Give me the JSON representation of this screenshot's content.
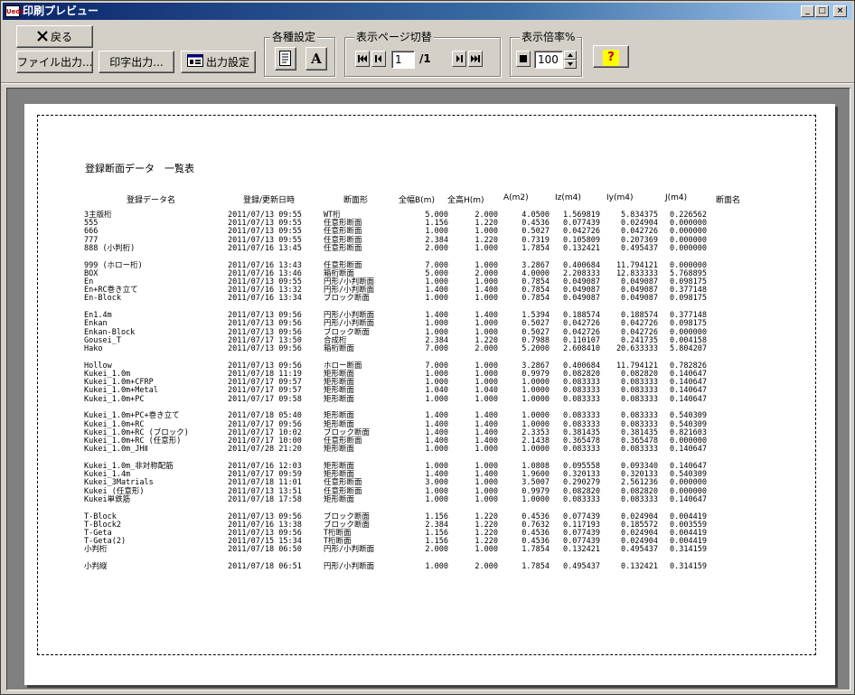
{
  "window": {
    "title": "印刷プレビュー",
    "app_icon": "app-logo-icon"
  },
  "toolbar": {
    "back_label": "戻る",
    "file_output_label": "ファイル出力...",
    "print_output_label": "印字出力...",
    "output_settings_label": "出力設定",
    "settings_group_label": "各種設定",
    "page_group_label": "表示ページ切替",
    "page_current": "1",
    "page_total": "/1",
    "zoom_group_label": "表示倍率%",
    "zoom_value": "100",
    "font_button_glyph": "A",
    "help_glyph": "?"
  },
  "document": {
    "title": "登録断面データ　一覧表",
    "headers": [
      "登録データ名",
      "登録/更新日時",
      "断面形",
      "全幅B(m)",
      "全高H(m)",
      "A(m2)",
      "Iz(m4)",
      "Iy(m4)",
      "J(m4)",
      "断面名"
    ],
    "groups": [
      [
        [
          "3主版桁",
          "2011/07/13 09:55",
          "WT桁",
          "5.000",
          "2.000",
          "4.0500",
          "1.569819",
          "5.834375",
          "0.226562"
        ],
        [
          "555",
          "2011/07/13 09:55",
          "任意形断面",
          "1.156",
          "1.220",
          "0.4536",
          "0.077439",
          "0.024904",
          "0.000000"
        ],
        [
          "666",
          "2011/07/13 09:55",
          "任意形断面",
          "1.000",
          "1.000",
          "0.5027",
          "0.042726",
          "0.042726",
          "0.000000"
        ],
        [
          "777",
          "2011/07/13 09:55",
          "任意形断面",
          "2.384",
          "1.220",
          "0.7319",
          "0.105809",
          "0.207369",
          "0.000000"
        ],
        [
          "888 (小判桁)",
          "2011/07/16 13:45",
          "任意形断面",
          "2.000",
          "1.000",
          "1.7854",
          "0.132421",
          "0.495437",
          "0.000000"
        ]
      ],
      [
        [
          "999 (ホロー桁)",
          "2011/07/16 13:43",
          "任意形断面",
          "7.000",
          "1.000",
          "3.2867",
          "0.400684",
          "11.794121",
          "0.000000"
        ],
        [
          "BOX",
          "2011/07/16 13:46",
          "箱桁断面",
          "5.000",
          "2.000",
          "4.0000",
          "2.208333",
          "12.833333",
          "5.768895"
        ],
        [
          "En",
          "2011/07/13 09:55",
          "円形/小判断面",
          "1.000",
          "1.000",
          "0.7854",
          "0.049087",
          "0.049087",
          "0.098175"
        ],
        [
          "En+RC巻き立て",
          "2011/07/16 13:32",
          "円形/小判断面",
          "1.400",
          "1.400",
          "0.7854",
          "0.049087",
          "0.049087",
          "0.377148"
        ],
        [
          "En-Block",
          "2011/07/16 13:34",
          "ブロック断面",
          "1.000",
          "1.000",
          "0.7854",
          "0.049087",
          "0.049087",
          "0.098175"
        ]
      ],
      [
        [
          "En1.4m",
          "2011/07/13 09:56",
          "円形/小判断面",
          "1.400",
          "1.400",
          "1.5394",
          "0.188574",
          "0.188574",
          "0.377148"
        ],
        [
          "Enkan",
          "2011/07/13 09:56",
          "円形/小判断面",
          "1.000",
          "1.000",
          "0.5027",
          "0.042726",
          "0.042726",
          "0.098175"
        ],
        [
          "Enkan-Block",
          "2011/07/13 09:56",
          "ブロック断面",
          "1.000",
          "1.000",
          "0.5027",
          "0.042726",
          "0.042726",
          "0.000000"
        ],
        [
          "Gousei_T",
          "2011/07/17 13:50",
          "合成桁",
          "2.384",
          "1.220",
          "0.7988",
          "0.110107",
          "0.241735",
          "0.004158"
        ],
        [
          "Hako",
          "2011/07/13 09:56",
          "箱桁断面",
          "7.000",
          "2.000",
          "5.2000",
          "2.608410",
          "20.633333",
          "5.804207"
        ]
      ],
      [
        [
          "Hollow",
          "2011/07/13 09:56",
          "ホロー断面",
          "7.000",
          "1.000",
          "3.2867",
          "0.400684",
          "11.794121",
          "0.782826"
        ],
        [
          "Kukei_1.0m",
          "2011/07/18 11:19",
          "矩形断面",
          "1.000",
          "1.000",
          "0.9979",
          "0.082820",
          "0.082820",
          "0.140647"
        ],
        [
          "Kukei_1.0m+CFRP",
          "2011/07/17 09:57",
          "矩形断面",
          "1.000",
          "1.000",
          "1.0000",
          "0.083333",
          "0.083333",
          "0.140647"
        ],
        [
          "Kukei_1.0m+Metal",
          "2011/07/17 09:57",
          "矩形断面",
          "1.040",
          "1.040",
          "1.0000",
          "0.083333",
          "0.083333",
          "0.140647"
        ],
        [
          "Kukei_1.0m+PC",
          "2011/07/17 09:58",
          "矩形断面",
          "1.000",
          "1.000",
          "1.0000",
          "0.083333",
          "0.083333",
          "0.140647"
        ]
      ],
      [
        [
          "Kukei_1.0m+PC+巻き立て",
          "2011/07/18 05:40",
          "矩形断面",
          "1.400",
          "1.400",
          "1.0000",
          "0.083333",
          "0.083333",
          "0.540309"
        ],
        [
          "Kukei_1.0m+RC",
          "2011/07/17 09:56",
          "矩形断面",
          "1.400",
          "1.400",
          "1.0000",
          "0.083333",
          "0.083333",
          "0.540309"
        ],
        [
          "Kukei_1.0m+RC (ブロック)",
          "2011/07/17 10:02",
          "ブロック断面",
          "1.400",
          "1.400",
          "2.3353",
          "0.381435",
          "0.381435",
          "0.821603"
        ],
        [
          "Kukei_1.0m+RC (任意形)",
          "2011/07/17 10:00",
          "任意形断面",
          "1.400",
          "1.400",
          "2.1438",
          "0.365478",
          "0.365478",
          "0.000000"
        ],
        [
          "Kukei_1.0m_JHⅡ",
          "2011/07/28 21:20",
          "矩形断面",
          "1.000",
          "1.000",
          "1.0000",
          "0.083333",
          "0.083333",
          "0.140647"
        ]
      ],
      [
        [
          "Kukei_1.0m_非対称配筋",
          "2011/07/16 12:03",
          "矩形断面",
          "1.000",
          "1.000",
          "1.0808",
          "0.095558",
          "0.093340",
          "0.140647"
        ],
        [
          "Kukei_1.4m",
          "2011/07/17 09:59",
          "矩形断面",
          "1.400",
          "1.400",
          "1.9600",
          "0.320133",
          "0.320133",
          "0.540309"
        ],
        [
          "Kukei_3Matrials",
          "2011/07/18 11:01",
          "任意形断面",
          "3.000",
          "1.000",
          "3.5007",
          "0.290279",
          "2.561236",
          "0.000000"
        ],
        [
          "Kukei (任意形)",
          "2011/07/13 13:51",
          "任意形断面",
          "1.000",
          "1.000",
          "0.9979",
          "0.082820",
          "0.082820",
          "0.000000"
        ],
        [
          "Kukei単鉄筋",
          "2011/07/18 17:58",
          "矩形断面",
          "1.000",
          "1.000",
          "1.0000",
          "0.083333",
          "0.083333",
          "0.140647"
        ]
      ],
      [
        [
          "T-Block",
          "2011/07/13 09:56",
          "ブロック断面",
          "1.156",
          "1.220",
          "0.4536",
          "0.077439",
          "0.024904",
          "0.004419"
        ],
        [
          "T-Block2",
          "2011/07/16 13:38",
          "ブロック断面",
          "2.384",
          "1.220",
          "0.7632",
          "0.117193",
          "0.185572",
          "0.003559"
        ],
        [
          "T-Geta",
          "2011/07/13 09:56",
          "T桁断面",
          "1.156",
          "1.220",
          "0.4536",
          "0.077439",
          "0.024904",
          "0.004419"
        ],
        [
          "T-Geta(2)",
          "2011/07/15 15:34",
          "T桁断面",
          "1.156",
          "1.220",
          "0.4536",
          "0.077439",
          "0.024904",
          "0.004419"
        ],
        [
          "小判桁",
          "2011/07/18 06:50",
          "円形/小判断面",
          "2.000",
          "1.000",
          "1.7854",
          "0.132421",
          "0.495437",
          "0.314159"
        ]
      ],
      [
        [
          "小判縦",
          "2011/07/18 06:51",
          "円形/小判断面",
          "1.000",
          "2.000",
          "1.7854",
          "0.495437",
          "0.132421",
          "0.314159"
        ]
      ]
    ]
  }
}
